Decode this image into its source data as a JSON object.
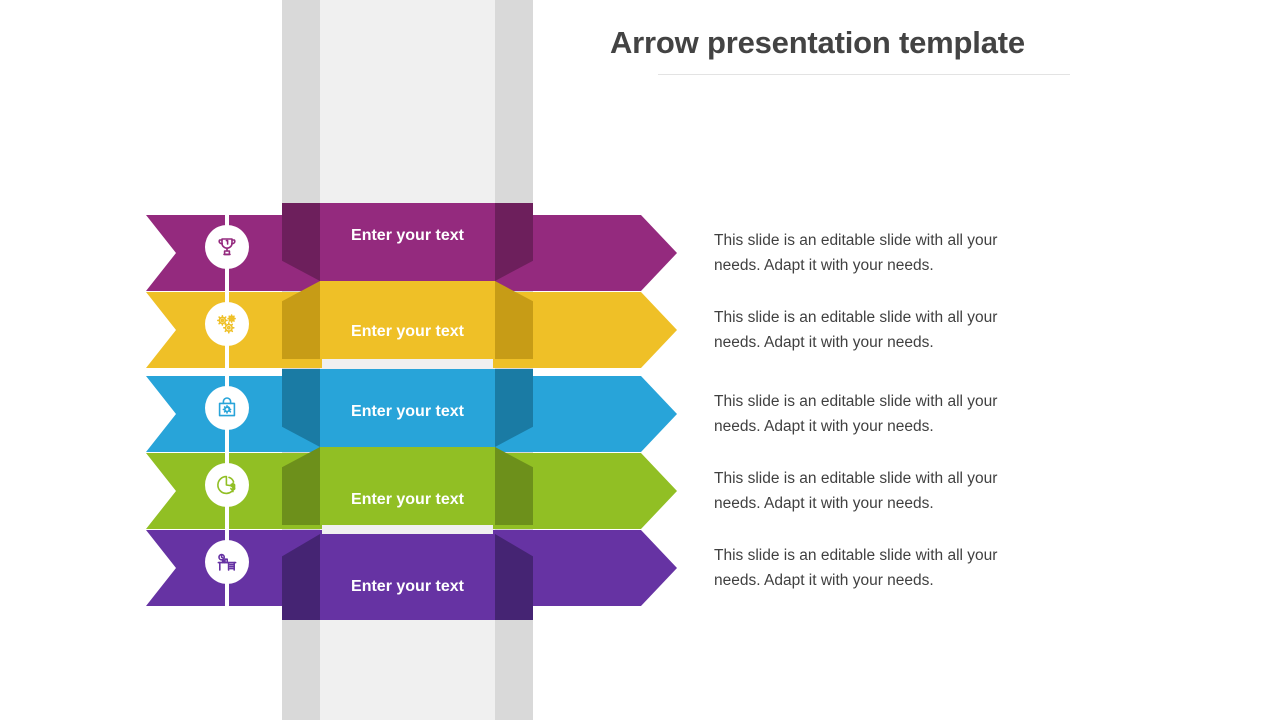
{
  "header": {
    "title": "Arrow presentation template"
  },
  "colors": {
    "magenta": "#942a7e",
    "magenta_dark": "#6d1f5c",
    "yellow": "#efc027",
    "yellow_dark": "#c79c16",
    "blue": "#28a4d9",
    "blue_dark": "#1a7ba4",
    "green": "#91bf24",
    "green_dark": "#6d901b",
    "violet": "#6633a3",
    "violet_dark": "#452473",
    "band_gray": "#d9d9d9",
    "band_light": "#f0f0f0",
    "title_text": "#434343",
    "body_text": "#404040",
    "panel_text": "#ffffff"
  },
  "rows": [
    {
      "label": "Enter your text",
      "description": "This slide is an editable slide with all your needs. Adapt it with your needs.",
      "icon": "trophy-icon",
      "color": "#942a7e",
      "color_dark": "#6d1f5c"
    },
    {
      "label": "Enter your text",
      "description": "This slide is an editable slide with all your needs. Adapt it with your needs.",
      "icon": "gears-icon",
      "color": "#efc027",
      "color_dark": "#c79c16"
    },
    {
      "label": "Enter your text",
      "description": "This slide is an editable slide with all your needs. Adapt it with your needs.",
      "icon": "shopping-bag-icon",
      "color": "#28a4d9",
      "color_dark": "#1a7ba4"
    },
    {
      "label": "Enter your text",
      "description": "This slide is an editable slide with all your needs. Adapt it with your needs.",
      "icon": "pie-chart-dollar-icon",
      "color": "#91bf24",
      "color_dark": "#6d901b"
    },
    {
      "label": "Enter your text",
      "description": "This slide is an editable slide with all your needs. Adapt it with your needs.",
      "icon": "desk-workspace-icon",
      "color": "#6633a3",
      "color_dark": "#452473"
    }
  ]
}
